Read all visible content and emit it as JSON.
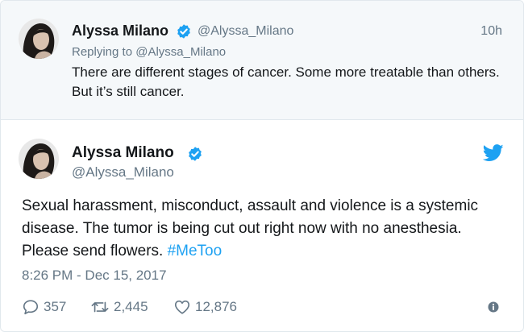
{
  "parent_tweet": {
    "author_name": "Alyssa Milano",
    "handle": "@Alyssa_Milano",
    "time": "10h",
    "reply_context": "Replying to @Alyssa_Milano",
    "text": "There are different stages of cancer. Some more treatable than others. But it’s still cancer."
  },
  "main_tweet": {
    "author_name": "Alyssa Milano",
    "handle": "@Alyssa_Milano",
    "text": "Sexual harassment, misconduct, assault and violence is a systemic disease. The tumor is being cut out right now with no anesthesia. Please send flowers. ",
    "hashtag": "#MeToo",
    "timestamp": "8:26 PM - Dec 15, 2017",
    "replies": "357",
    "retweets": "2,445",
    "likes": "12,876"
  },
  "icons": {
    "verified": "verified-badge-icon",
    "brand": "twitter-bird-icon",
    "reply": "reply-icon",
    "retweet": "retweet-icon",
    "like": "heart-icon",
    "info": "info-icon"
  },
  "colors": {
    "accent": "#1da1f2",
    "muted": "#657786",
    "parent_background": "#f5f8fa"
  }
}
